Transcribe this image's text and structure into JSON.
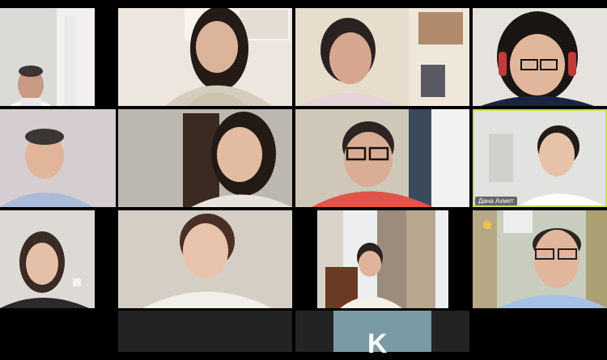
{
  "participants": [
    {
      "id": "p1",
      "name_label": ""
    },
    {
      "id": "p2",
      "name_label": ""
    },
    {
      "id": "p3",
      "name_label": ""
    },
    {
      "id": "p4",
      "name_label": ""
    },
    {
      "id": "p5",
      "name_label": ""
    },
    {
      "id": "p6",
      "name_label": ""
    },
    {
      "id": "p7",
      "name_label": ""
    },
    {
      "id": "p8",
      "name_label": "Дана Ахмет"
    },
    {
      "id": "p9",
      "name_label": ""
    },
    {
      "id": "p10",
      "name_label": ""
    },
    {
      "id": "p11",
      "name_label": ""
    },
    {
      "id": "p12",
      "name_label": ""
    }
  ],
  "avatar_tile": {
    "initial": "K"
  },
  "colors": {
    "active_speaker": "#c8e04a",
    "avatar_bg": "#7a9aa6"
  }
}
